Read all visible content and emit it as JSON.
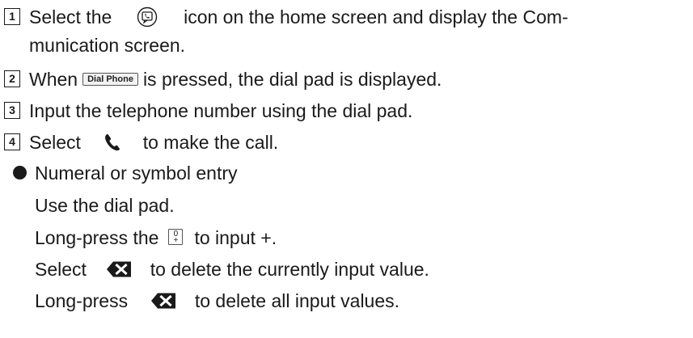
{
  "steps": [
    {
      "number": "1",
      "line1_before": "Select the",
      "icon": "communication-icon",
      "line1_after": "icon on the home screen and display the Com-",
      "line2": "munication screen."
    },
    {
      "number": "2",
      "before": "When",
      "button_label": "Dial Phone",
      "after": "is pressed, the dial pad is displayed."
    },
    {
      "number": "3",
      "text": "Input the telephone number using the dial pad."
    },
    {
      "number": "4",
      "before": "Select",
      "icon": "phone-handset-icon",
      "after": "to make the call."
    }
  ],
  "note": {
    "heading": "Numeral or symbol entry",
    "line1": "Use the dial pad.",
    "line2_before": "Long-press the",
    "key_label_top": "0",
    "key_label_bottom": "+",
    "line2_after": "to input +.",
    "line3_before": "Select",
    "line3_icon": "backspace-delete-icon",
    "line3_after": "to delete the currently input value.",
    "line4_before": "Long-press",
    "line4_icon": "backspace-delete-icon",
    "line4_after": "to delete all input values."
  }
}
